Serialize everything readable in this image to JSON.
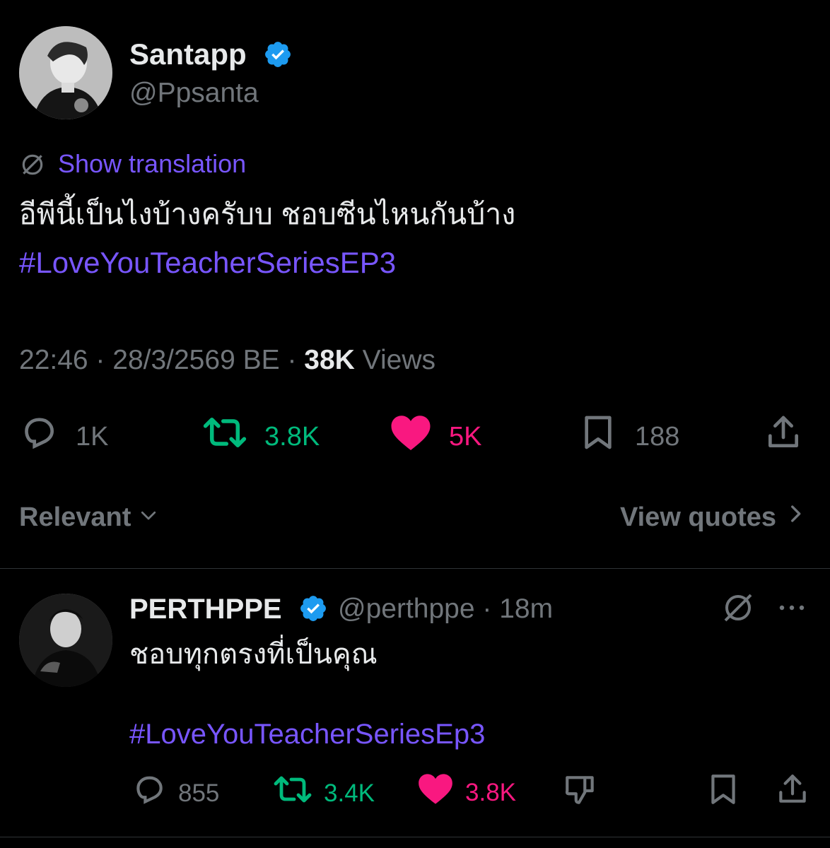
{
  "main_tweet": {
    "display_name": "Santapp",
    "handle": "@Ppsanta",
    "show_translation": "Show translation",
    "text": "อีพีนี้เป็นไงบ้างครับบ ชอบซีนไหนกันบ้าง",
    "hashtag": "#LoveYouTeacherSeriesEP3",
    "timestamp": "22:46 · 28/3/2569 BE · ",
    "views_count": "38K",
    "views_label": " Views",
    "actions": {
      "replies": "1K",
      "retweets": "3.8K",
      "likes": "5K",
      "bookmarks": "188"
    }
  },
  "sort_label": "Relevant",
  "view_quotes_label": "View quotes",
  "reply": {
    "display_name": "PERTHPPE",
    "handle_time": "@perthppe · 18m",
    "text": "ชอบทุกตรงที่เป็นคุณ",
    "hashtag": "#LoveYouTeacherSeriesEp3",
    "actions": {
      "replies": "855",
      "retweets": "3.4K",
      "likes": "3.8K"
    }
  },
  "colors": {
    "background": "#000000",
    "text": "#e7e9ea",
    "muted": "#71767b",
    "accent": "#7856ff",
    "verified": "#1d9bf0",
    "retweet": "#00ba7c",
    "like": "#f91880"
  },
  "icons": [
    "translate-icon",
    "verified-badge-icon",
    "reply-icon",
    "retweet-icon",
    "heart-icon",
    "bookmark-icon",
    "share-icon",
    "chevron-down-icon",
    "chevron-right-icon",
    "more-icon",
    "downvote-icon"
  ]
}
